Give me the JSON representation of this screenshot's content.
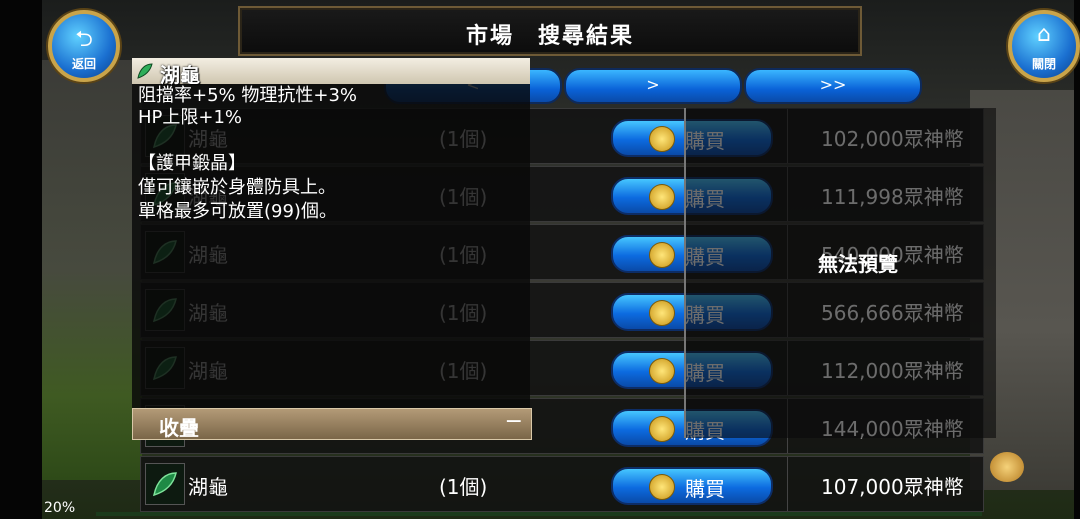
{
  "title": "市場　搜尋結果",
  "back_label": "返回",
  "close_label": "關閉",
  "pager": {
    "prev": "<",
    "next": ">",
    "last": ">>"
  },
  "tooltip": {
    "name": "湖龜",
    "stats_line1": "阻擋率+5%  物理抗性+3%",
    "stats_line2": "HP上限+1%",
    "category": "【護甲鍛晶】",
    "desc_line1": "僅可鑲嵌於身體防具上。",
    "desc_line2": "單格最多可放置(99)個。",
    "collapse_label": "收疊",
    "collapse_icon": "−"
  },
  "preview_unavailable": "無法預覽",
  "buy_label": "購買",
  "rows": [
    {
      "name": "湖龜",
      "qty": "(1個)",
      "price": "102,000眾神幣"
    },
    {
      "name": "湖龜",
      "qty": "(1個)",
      "price": "111,998眾神幣"
    },
    {
      "name": "湖龜",
      "qty": "(1個)",
      "price": "540,000眾神幣"
    },
    {
      "name": "湖龜",
      "qty": "(1個)",
      "price": "566,666眾神幣"
    },
    {
      "name": "湖龜",
      "qty": "(1個)",
      "price": "112,000眾神幣"
    },
    {
      "name": "湖龜",
      "qty": "(1個)",
      "price": "144,000眾神幣"
    },
    {
      "name": "湖龜",
      "qty": "(1個)",
      "price": "107,000眾神幣"
    }
  ],
  "status_text": "20%"
}
